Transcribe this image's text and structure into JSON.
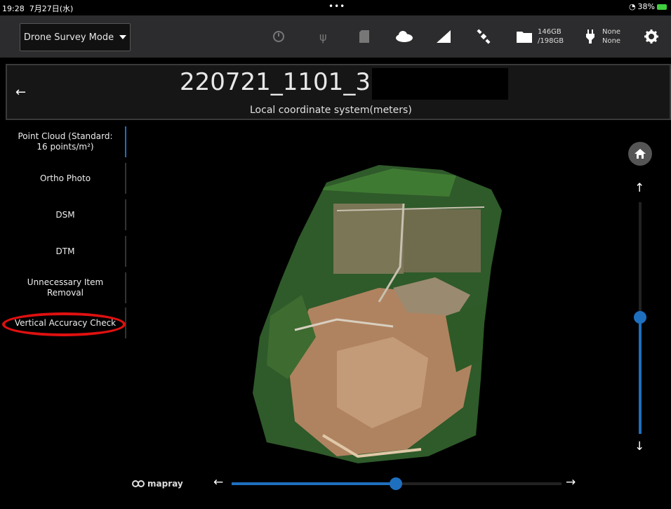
{
  "status_bar": {
    "time": "19:28",
    "date": "7月27日(水)",
    "battery": "38%"
  },
  "header": {
    "mode_label": "Drone Survey Mode",
    "storage_used": "146GB",
    "storage_total": "/198GB",
    "power_line1": "None",
    "power_line2": "None"
  },
  "project": {
    "title": "220721_1101_33_",
    "coordinate_system": "Local coordinate system(meters)"
  },
  "sidebar": {
    "items": [
      {
        "line1": "Point Cloud (Standard:",
        "line2": "16 points/m²"
      },
      {
        "line1": "Ortho Photo",
        "line2": ""
      },
      {
        "line1": "DSM",
        "line2": ""
      },
      {
        "line1": "DTM",
        "line2": ""
      },
      {
        "line1": "Unnecessary Item",
        "line2": "Removal"
      },
      {
        "line1": "Vertical Accuracy Check",
        "line2": ""
      }
    ]
  },
  "viewer": {
    "brand": "mapray",
    "vertical_slider_value": 0.5,
    "horizontal_slider_value": 0.5
  },
  "colors": {
    "accent": "#1f6fbf",
    "highlight_annotation": "#e01010",
    "header_bg": "#2c2c2e"
  }
}
